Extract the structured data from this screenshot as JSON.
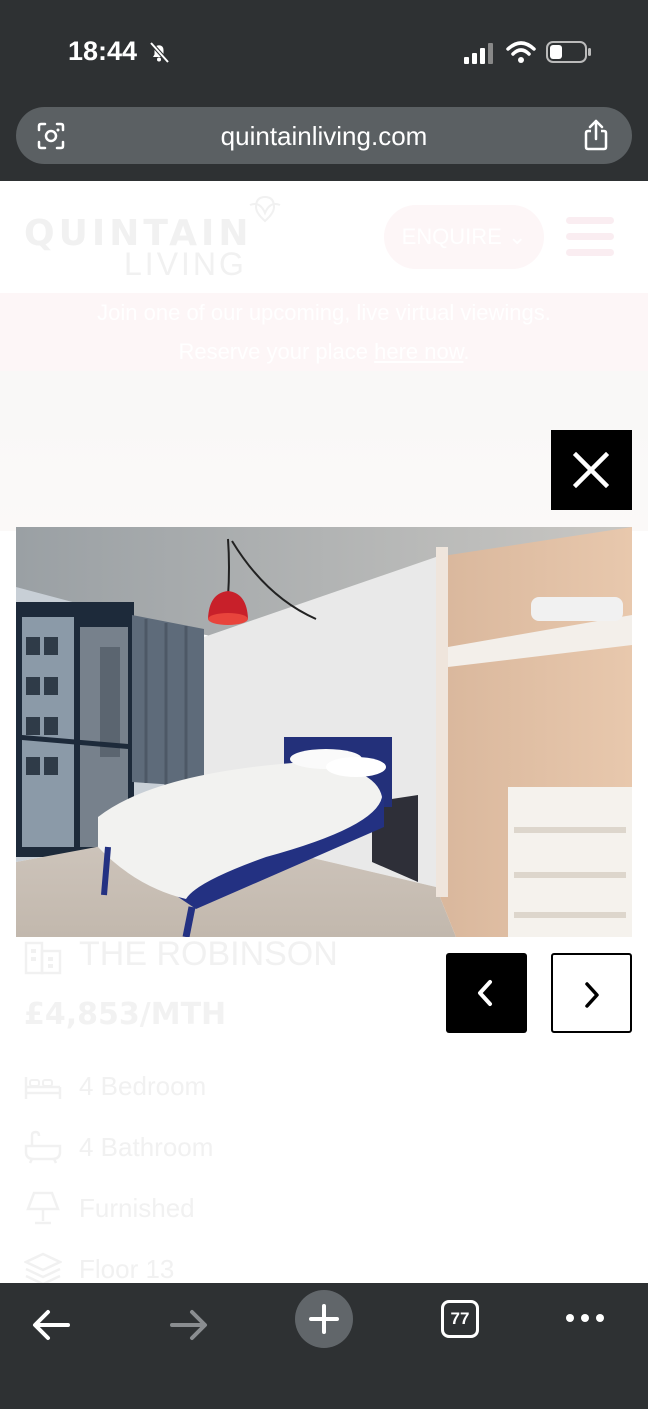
{
  "status_bar": {
    "time": "18:44"
  },
  "browser": {
    "url": "quintainliving.com",
    "tab_count": "77"
  },
  "site": {
    "logo_top": "QUINTAIN",
    "logo_bottom": "LIVING",
    "enquire_label": "ENQUIRE",
    "banner_line1": "Join one of our upcoming, live virtual viewings.",
    "banner_line2_prefix": "Reserve your place ",
    "banner_link": "here now",
    "banner_line2_suffix": "."
  },
  "property": {
    "name": "THE ROBINSON",
    "price": "£4,853/MTH",
    "features": [
      {
        "icon": "bed-icon",
        "label": "4 Bedroom"
      },
      {
        "icon": "bath-icon",
        "label": "4 Bathroom"
      },
      {
        "icon": "lamp-icon",
        "label": "Furnished"
      },
      {
        "icon": "layers-icon",
        "label": "Floor 13"
      }
    ]
  },
  "colors": {
    "chrome": "#2e3133",
    "brand_pink": "#fbeef1",
    "lightbox_button": "#000000"
  }
}
